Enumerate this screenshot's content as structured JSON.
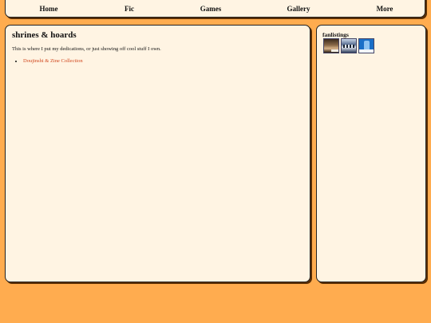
{
  "nav": {
    "items": [
      "Home",
      "Fic",
      "Games",
      "Gallery",
      "More"
    ]
  },
  "main": {
    "title": "shrines & hoards",
    "intro": "This is where I put my dedications, or just showing off cool stuff I own.",
    "links": [
      "Doujinshi & Zine Collection"
    ]
  },
  "sidebar": {
    "title": "fanlistings",
    "badges": [
      "fanlisting-badge-portrait",
      "fanlisting-badge-station",
      "fanlisting-badge-handheld"
    ]
  },
  "colors": {
    "background": "#ffac4f",
    "panel": "#fff4e3",
    "link": "#d0451c"
  }
}
